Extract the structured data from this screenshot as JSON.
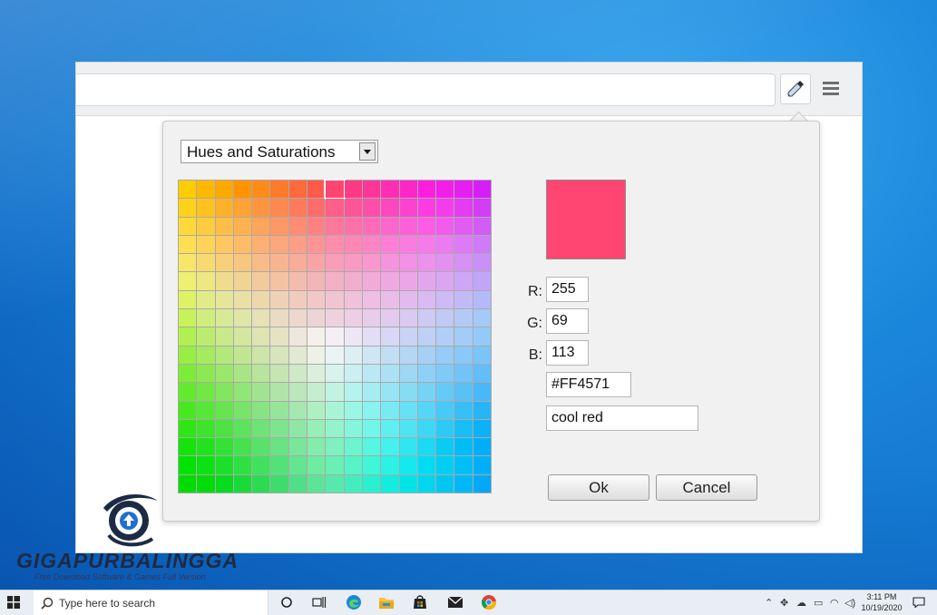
{
  "palette_selector": {
    "value": "Hues and Saturations"
  },
  "swatch_grid": {
    "rows": [
      [
        "#FFCC00",
        "#FFB800",
        "#FFA800",
        "#FF9400",
        "#FF8C19",
        "#FF7A2A",
        "#FF6A3A",
        "#FF5A4A",
        "#FF4571",
        "#FF3A84",
        "#FF3699",
        "#FF2EB2",
        "#FF26C8",
        "#FF1EDE",
        "#F41EEA",
        "#E51EF2",
        "#D61EF8"
      ],
      [
        "#FFD21A",
        "#FFC21F",
        "#FFB228",
        "#FFA332",
        "#FF963F",
        "#FF884C",
        "#FF7B5B",
        "#FF6D6A",
        "#FF5F88",
        "#FF5595",
        "#FF4FAB",
        "#FF48BF",
        "#FF41D1",
        "#FF3CE3",
        "#F53CEC",
        "#E53CF3",
        "#D43CF8"
      ],
      [
        "#FFD93A",
        "#FFCB3F",
        "#FFBE47",
        "#FFB150",
        "#FFA45B",
        "#FF9866",
        "#FF8C73",
        "#FF8181",
        "#FF779A",
        "#FF70A7",
        "#FF6BB8",
        "#FF66CB",
        "#FF60DA",
        "#FC5CE6",
        "#F25CEE",
        "#E25CF4",
        "#D25CF8"
      ],
      [
        "#FEDE52",
        "#FED359",
        "#FEC760",
        "#FEBC68",
        "#FEB072",
        "#FEA77D",
        "#FE9E88",
        "#FE9595",
        "#FE8EAB",
        "#FE87B6",
        "#FE84C5",
        "#FE7FD5",
        "#FC7BE1",
        "#F67AEA",
        "#EC7AF0",
        "#DE7AF5",
        "#CF7AF8"
      ],
      [
        "#F8E66A",
        "#F8DB70",
        "#F8D077",
        "#F8C77E",
        "#F8BC87",
        "#F8B490",
        "#F8AC9A",
        "#F8A4A6",
        "#F89EB8",
        "#F89BC2",
        "#F898CF",
        "#F594DC",
        "#F291E6",
        "#EC91EC",
        "#E391F1",
        "#D691F5",
        "#C991F8"
      ],
      [
        "#EEF072",
        "#EFE684",
        "#F0DC8D",
        "#F1D494",
        "#F2CB9C",
        "#F3C3A4",
        "#F3BCAC",
        "#F3B6B6",
        "#F3B1C5",
        "#F3AECE",
        "#F2ABD8",
        "#EFA8E2",
        "#EAA6E9",
        "#E3A6EE",
        "#DAA6F2",
        "#CEA6F5",
        "#C1A6F8"
      ],
      [
        "#DDF267",
        "#E1EC88",
        "#E6E69A",
        "#EADFA4",
        "#EDD8AE",
        "#EFD2B6",
        "#F0CCBF",
        "#F0C8C8",
        "#F0C4D3",
        "#F0C1DB",
        "#EFBEE2",
        "#EABCE8",
        "#E3BAEE",
        "#DABAF1",
        "#CFBAF4",
        "#C2BAF6",
        "#B4BAF8"
      ],
      [
        "#C8F25C",
        "#D0EE7E",
        "#D9EA96",
        "#E0E5A8",
        "#E6E1B6",
        "#EADCC2",
        "#ECD8CC",
        "#EDD5D5",
        "#EDD2DE",
        "#ECCFE4",
        "#E8CDEA",
        "#E1CBEE",
        "#D8CAF1",
        "#CDCAF3",
        "#C1CAF5",
        "#B4CAF6",
        "#A6CAF8"
      ],
      [
        "#B0F050",
        "#BCEC6F",
        "#C9E98A",
        "#D4E6A0",
        "#DEE4B2",
        "#E6E2C4",
        "#EEE8DC",
        "#F4F0EC",
        "#F5EEF5",
        "#EEE6F6",
        "#E2DEF5",
        "#D6D8F5",
        "#CAD2F5",
        "#BED0F6",
        "#B1CEF6",
        "#A3CCF7",
        "#94CAF8"
      ],
      [
        "#98EE44",
        "#A5EB60",
        "#B3E87A",
        "#C0E692",
        "#CCE5A8",
        "#D7E5BC",
        "#E2E9D2",
        "#ECF3E6",
        "#EAF4F4",
        "#DDEEF4",
        "#CFE6F4",
        "#C1DEF4",
        "#B3D7F4",
        "#A5D1F5",
        "#97CCF6",
        "#89C8F7",
        "#7BC4F8"
      ],
      [
        "#7DEC38",
        "#8CE952",
        "#9BE76C",
        "#AAE585",
        "#B8E49C",
        "#C5E5B3",
        "#D1E8C8",
        "#DCEFDC",
        "#D8F2EC",
        "#CBEFF3",
        "#BCE8F4",
        "#ADE0F4",
        "#9ED8F5",
        "#8FD1F6",
        "#80CAF7",
        "#72C3F8",
        "#63BDF8"
      ],
      [
        "#63EA2C",
        "#72E844",
        "#82E65E",
        "#92E577",
        "#A1E48F",
        "#AFE5A6",
        "#BCE7BC",
        "#C6EECE",
        "#C2F3E2",
        "#B4F3EE",
        "#A5EDF3",
        "#95E5F4",
        "#85DCF5",
        "#75D3F6",
        "#66CAF7",
        "#57C1F8",
        "#48B8F8"
      ],
      [
        "#48E820",
        "#57E737",
        "#67E550",
        "#78E46A",
        "#88E482",
        "#97E59A",
        "#A5E8B0",
        "#AFEFC2",
        "#AAF4D6",
        "#9AF6E5",
        "#8AF2EF",
        "#79EAF3",
        "#68E0F5",
        "#57D5F6",
        "#47CAF7",
        "#38BFF8",
        "#2AB4F8"
      ],
      [
        "#2EE614",
        "#3CE52A",
        "#4DE443",
        "#5EE35C",
        "#6FE376",
        "#7FE48F",
        "#8FE7A6",
        "#99EDB7",
        "#94F3CB",
        "#84F6DB",
        "#72F6E9",
        "#60EEF1",
        "#4EE4F4",
        "#3CD8F5",
        "#2BCBF6",
        "#1ABEF7",
        "#0CB1F8"
      ],
      [
        "#14E40A",
        "#21E31D",
        "#32E234",
        "#45E24E",
        "#57E268",
        "#69E383",
        "#79E69A",
        "#84ECAC",
        "#7EF1BF",
        "#6CF5D0",
        "#58F6E0",
        "#44F1EC",
        "#30E6F2",
        "#1CD9F4",
        "#0ACBF6",
        "#00BDF7",
        "#00AEF8"
      ],
      [
        "#00E200",
        "#0AE212",
        "#1AE128",
        "#2DE142",
        "#40E15D",
        "#53E278",
        "#64E590",
        "#70EBA2",
        "#6AEFB5",
        "#56F4C7",
        "#40F6D8",
        "#2AF3E6",
        "#14EAEE",
        "#00DDF3",
        "#00CEF5",
        "#00BFF7",
        "#00AFF8"
      ],
      [
        "#00DC00",
        "#00DC08",
        "#06DB1E",
        "#18DB37",
        "#2BDB52",
        "#3EDC6D",
        "#50DF86",
        "#5DE498",
        "#56E9AB",
        "#42EEBE",
        "#2AF0CF",
        "#12EDDE",
        "#00E4E8",
        "#00D6EE",
        "#00C7F2",
        "#00B8F5",
        "#00A8F7"
      ]
    ]
  },
  "selected_color": {
    "hex_color": "#FF4571",
    "r_label": "R:",
    "r_value": "255",
    "g_label": "G:",
    "g_value": "69",
    "b_label": "B:",
    "b_value": "113",
    "hex_value": "#FF4571",
    "name_value": "cool red"
  },
  "buttons": {
    "ok_label": "Ok",
    "cancel_label": "Cancel"
  },
  "watermark": {
    "title": "GIGAPURBALINGGA",
    "subtitle": "Free Download Software & Games Full Version"
  },
  "taskbar": {
    "search_placeholder": "Type here to search",
    "time": "3:11 PM",
    "date": "10/19/2020"
  },
  "icons": {
    "eyedropper": "eyedropper-icon",
    "menu": "hamburger-menu-icon",
    "start": "windows-start-icon",
    "search": "search-icon",
    "task_view": "task-view-icon",
    "edge": "edge-browser-icon",
    "explorer": "file-explorer-icon",
    "store": "store-icon",
    "mail": "mail-icon",
    "chrome": "chrome-icon",
    "notifications": "notification-icon"
  }
}
